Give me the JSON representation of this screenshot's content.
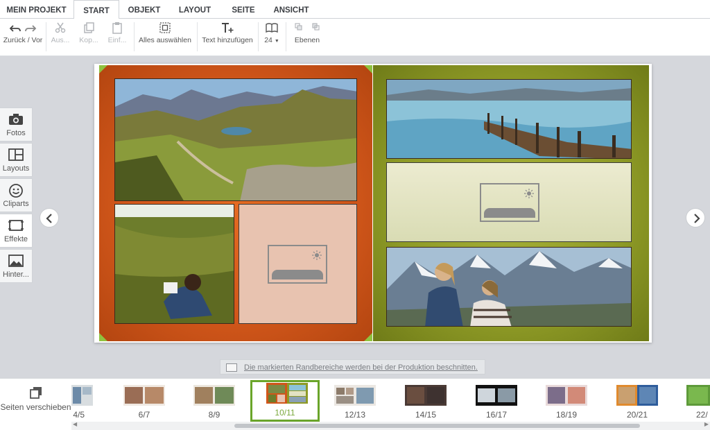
{
  "menu": {
    "tabs": [
      {
        "label": "MEIN PROJEKT"
      },
      {
        "label": "START"
      },
      {
        "label": "OBJEKT"
      },
      {
        "label": "LAYOUT"
      },
      {
        "label": "SEITE"
      },
      {
        "label": "ANSICHT"
      }
    ],
    "active_tab": "START"
  },
  "toolbar": {
    "undo_redo_label": "Zurück / Vor",
    "cut_label": "Aus...",
    "copy_label": "Kop...",
    "paste_label": "Einf...",
    "select_all_label": "Alles auswählen",
    "add_text_label": "Text hinzufügen",
    "font_size_value": "24",
    "layers_label": "Ebenen"
  },
  "sidebar": {
    "items": [
      {
        "label": "Fotos",
        "icon": "camera-icon"
      },
      {
        "label": "Layouts",
        "icon": "layout-grid-icon"
      },
      {
        "label": "Cliparts",
        "icon": "smiley-icon"
      },
      {
        "label": "Effekte",
        "icon": "frame-effects-icon"
      },
      {
        "label": "Hinter...",
        "icon": "background-image-icon"
      }
    ],
    "active_item": "Effekte"
  },
  "colors": {
    "left_page": "#d0561a",
    "right_page": "#8e9a26",
    "corner_marker": "#8fc23f",
    "active_thumb_border": "#6aa52a"
  },
  "notice": {
    "text": "Die markierten Randbereiche werden bei der Produktion beschnitten."
  },
  "strip": {
    "move_pages_label": "Seiten verschieben",
    "thumbnails": [
      {
        "label": "4/5"
      },
      {
        "label": "6/7"
      },
      {
        "label": "8/9"
      },
      {
        "label": "10/11"
      },
      {
        "label": "12/13"
      },
      {
        "label": "14/15"
      },
      {
        "label": "16/17"
      },
      {
        "label": "18/19"
      },
      {
        "label": "20/21"
      },
      {
        "label": "22/"
      }
    ],
    "active_thumbnail": "10/11"
  }
}
